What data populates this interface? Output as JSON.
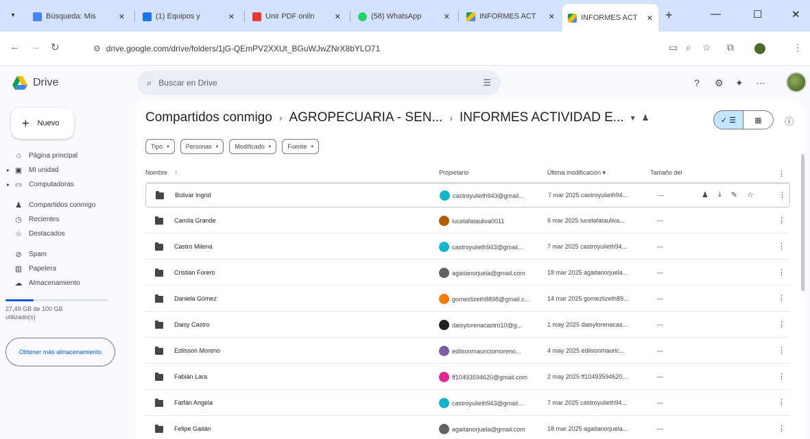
{
  "browser": {
    "tabs": [
      {
        "title": "Búsqueda: Mis",
        "favicon_color": "#4285f4"
      },
      {
        "title": "(1) Equipos y",
        "favicon_color": "#1a73e8"
      },
      {
        "title": "Unir PDF onlin",
        "favicon_color": "#e53935"
      },
      {
        "title": "(58) WhatsApp",
        "favicon_color": "#25d366"
      },
      {
        "title": "INFORMES ACT",
        "favicon_color": "#0f9d58"
      },
      {
        "title": "INFORMES ACT",
        "favicon_color": "#0f9d58",
        "active": true
      }
    ],
    "url": "drive.google.com/drive/folders/1jG-QEmPV2XXUt_BGuWJwZNrX8bYLO71",
    "new_tab_symbol": "+",
    "minimize_symbol": "—",
    "maximize_symbol": "☐",
    "close_symbol": "✕"
  },
  "app": {
    "logo_text": "Drive",
    "search_placeholder": "Buscar en Drive"
  },
  "sidebar": {
    "new_label": "Nuevo",
    "items": [
      {
        "label": "Página principal",
        "icon": "home-icon"
      },
      {
        "label": "Mi unidad",
        "icon": "my-drive-icon"
      },
      {
        "label": "Computadoras",
        "icon": "computers-icon"
      },
      {
        "label": "Compartidos conmigo",
        "icon": "shared-icon"
      },
      {
        "label": "Recientes",
        "icon": "recent-icon"
      },
      {
        "label": "Destacados",
        "icon": "starred-icon"
      },
      {
        "label": "Spam",
        "icon": "spam-icon"
      },
      {
        "label": "Papelera",
        "icon": "trash-icon"
      },
      {
        "label": "Almacenamiento",
        "icon": "storage-icon"
      }
    ],
    "storage_text": "27,49 GB de 100 GB utilizado(s)",
    "storage_fraction": 0.27,
    "get_more_label": "Obtener más almacenamiento"
  },
  "main": {
    "breadcrumb": [
      "Compartidos conmigo",
      "AGROPECUARIA - SEN...",
      "INFORMES ACTIVIDAD E..."
    ],
    "filters": [
      "Tipo",
      "Personas",
      "Modificado",
      "Fuente"
    ],
    "columns": {
      "name": "Nombre",
      "owner": "Propietario",
      "modified": "Última modificación",
      "size": "Tamaño del"
    },
    "rows": [
      {
        "name": "Bolivar Ingrid",
        "owner": "castroyulieth943@gmail...",
        "owner_color": "#12b5cb",
        "modified": "7 mar 2025 castroyulieth94...",
        "size": "—"
      },
      {
        "name": "Camila Grande",
        "owner": "lucelafatauliva0011",
        "owner_color": "#b06000",
        "modified": "6 mar 2025 lucelafatauliva...",
        "size": "—"
      },
      {
        "name": "Castro Milena",
        "owner": "castroyulieth943@gmail...",
        "owner_color": "#12b5cb",
        "modified": "7 mar 2025 castroyulieth94...",
        "size": "—"
      },
      {
        "name": "Cristian Forero",
        "owner": "agaitanorjuela@gmail.com",
        "owner_color": "#5f6368",
        "modified": "18 mar 2025 agaitanorjuela...",
        "size": "—"
      },
      {
        "name": "Daniela Gómez",
        "owner": "gomezlizeth8898@gmail.c...",
        "owner_color": "#f57c00",
        "modified": "14 mar 2025 gomezlizeth89...",
        "size": "—"
      },
      {
        "name": "Daisy Castro",
        "owner": "daisylorenacastro10@g...",
        "owner_color": "#202124",
        "modified": "1 may 2025 daisylorenacas...",
        "size": "—"
      },
      {
        "name": "Edilsson Moreno",
        "owner": "edilsonmauriciomoreno...",
        "owner_color": "#7b5ea7",
        "modified": "4 may 2025 edilsonmauric...",
        "size": "—"
      },
      {
        "name": "Fabián Lara",
        "owner": "ff10493594620@gmail.com",
        "owner_color": "#e52592",
        "modified": "2 may 2025 ff10493594620...",
        "size": "—"
      },
      {
        "name": "Farfán Angela",
        "owner": "castroyulieth943@gmail...",
        "owner_color": "#12b5cb",
        "modified": "7 mar 2025 castroyulieth94...",
        "size": "—"
      },
      {
        "name": "Felipe Gaitán",
        "owner": "agaitanorjuela@gmail.com",
        "owner_color": "#5f6368",
        "modified": "18 mar 2025 agaitanorjuela...",
        "size": "—"
      }
    ]
  }
}
